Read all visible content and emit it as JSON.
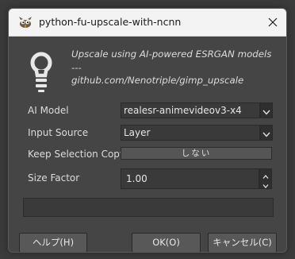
{
  "window": {
    "title": "python-fu-upscale-with-ncnn",
    "close_icon": "close-icon",
    "app_icon": "gimp-wilber-icon"
  },
  "description": {
    "line1": "Upscale using AI-powered ESRGAN models",
    "line2": "---",
    "line3": "github.com/Nenotriple/gimp_upscale",
    "icon": "lightbulb-icon"
  },
  "fields": {
    "ai_model": {
      "label": "AI Model",
      "value": "realesr-animevideov3-x4"
    },
    "input_source": {
      "label": "Input Source",
      "value": "Layer"
    },
    "keep_selection_copy": {
      "label": "Keep Selection Copy",
      "value": "しない"
    },
    "size_factor": {
      "label": "Size Factor",
      "value": "1.00"
    }
  },
  "progress": {
    "fraction": 0.0
  },
  "buttons": {
    "help": "ヘルプ(H)",
    "ok": "OK(O)",
    "cancel": "キャンセル(C)"
  },
  "colors": {
    "background": "#454545",
    "titlebar": "#f3f3f3",
    "text": "#dcdcdc",
    "field_bg": "#3a3a3a",
    "button_bg": "#585858"
  }
}
